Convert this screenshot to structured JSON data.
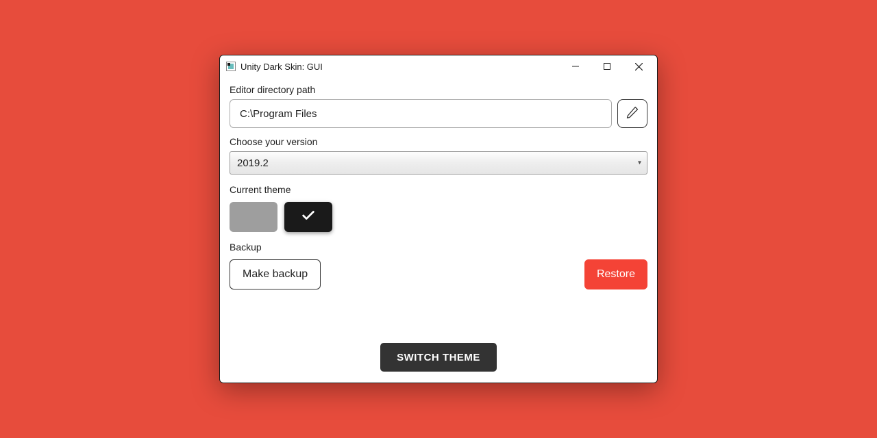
{
  "window": {
    "title": "Unity Dark Skin: GUI"
  },
  "labels": {
    "editor_path": "Editor directory path",
    "choose_version": "Choose your version",
    "current_theme": "Current theme",
    "backup": "Backup"
  },
  "inputs": {
    "editor_path_value": "C:\\Program Files"
  },
  "version": {
    "selected": "2019.2"
  },
  "theme": {
    "selected": "dark"
  },
  "buttons": {
    "make_backup": "Make backup",
    "restore": "Restore",
    "switch_theme": "SWITCH THEME"
  }
}
